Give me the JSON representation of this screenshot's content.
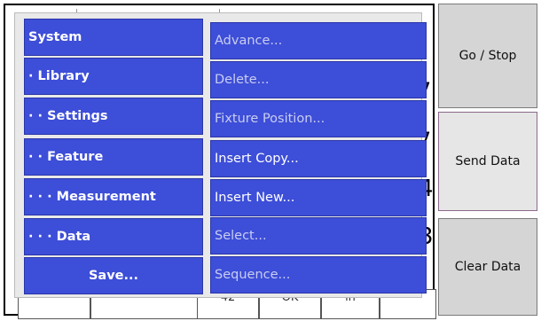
{
  "menu": {
    "left": [
      {
        "label": "System"
      },
      {
        "label": "· Library"
      },
      {
        "label": "· · Settings"
      },
      {
        "label": "· · Feature"
      },
      {
        "label": "· · · Measurement"
      },
      {
        "label": "· · · Data"
      },
      {
        "label": "Save..."
      }
    ],
    "right": [
      {
        "label": "Advance..."
      },
      {
        "label": "Delete..."
      },
      {
        "label": "Fixture Position..."
      },
      {
        "label": "Insert Copy..."
      },
      {
        "label": "Insert New..."
      },
      {
        "label": "Select..."
      },
      {
        "label": "Sequence..."
      }
    ]
  },
  "side_buttons": {
    "go_stop": "Go / Stop",
    "send_data": "Send Data",
    "clear_data": "Clear Data"
  },
  "background": {
    "digits": [
      "7",
      "7",
      "4",
      "3"
    ],
    "bottom_cells": [
      "42",
      "OK",
      "in"
    ]
  }
}
